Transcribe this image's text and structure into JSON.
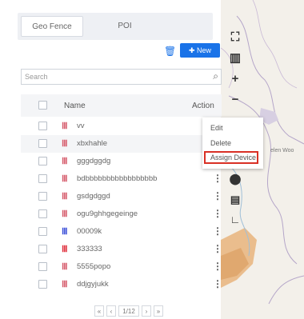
{
  "tabs": [
    {
      "label": "Geo Fence",
      "active": true
    },
    {
      "label": "POI",
      "active": false
    }
  ],
  "toolbar": {
    "new_label": "New",
    "delete_icon": "trash-icon"
  },
  "search": {
    "placeholder": "Search",
    "icon": "search-icon"
  },
  "table": {
    "headers": {
      "name": "Name",
      "action": "Action"
    },
    "rows": [
      {
        "name": "vv",
        "icon_color": "#d65b6b"
      },
      {
        "name": "xbxhahle",
        "icon_color": "#d65b6b"
      },
      {
        "name": "gggdggdg",
        "icon_color": "#d65b6b"
      },
      {
        "name": "bdbbbbbbbbbbbbbbbbb",
        "icon_color": "#d65b6b"
      },
      {
        "name": "gsdgdggd",
        "icon_color": "#d65b6b"
      },
      {
        "name": "ogu9ghhgegeinge",
        "icon_color": "#d65b6b"
      },
      {
        "name": "00009k",
        "icon_color": "#3b4fd8"
      },
      {
        "name": "333333",
        "icon_color": "#e02f3c"
      },
      {
        "name": "5555popo",
        "icon_color": "#d65b6b"
      },
      {
        "name": "ddjgyjukk",
        "icon_color": "#d65b6b"
      }
    ]
  },
  "pager": {
    "first": "«",
    "prev": "‹",
    "page": "1/12",
    "next": "›",
    "last": "»"
  },
  "action_menu": {
    "edit": "Edit",
    "delete": "Delete",
    "assign": "Assign Device"
  },
  "map": {
    "labels": [
      "elen Woo"
    ],
    "accent": "#e3a56b"
  },
  "colors": {
    "primary": "#1a73e8",
    "highlight": "#d93025"
  }
}
